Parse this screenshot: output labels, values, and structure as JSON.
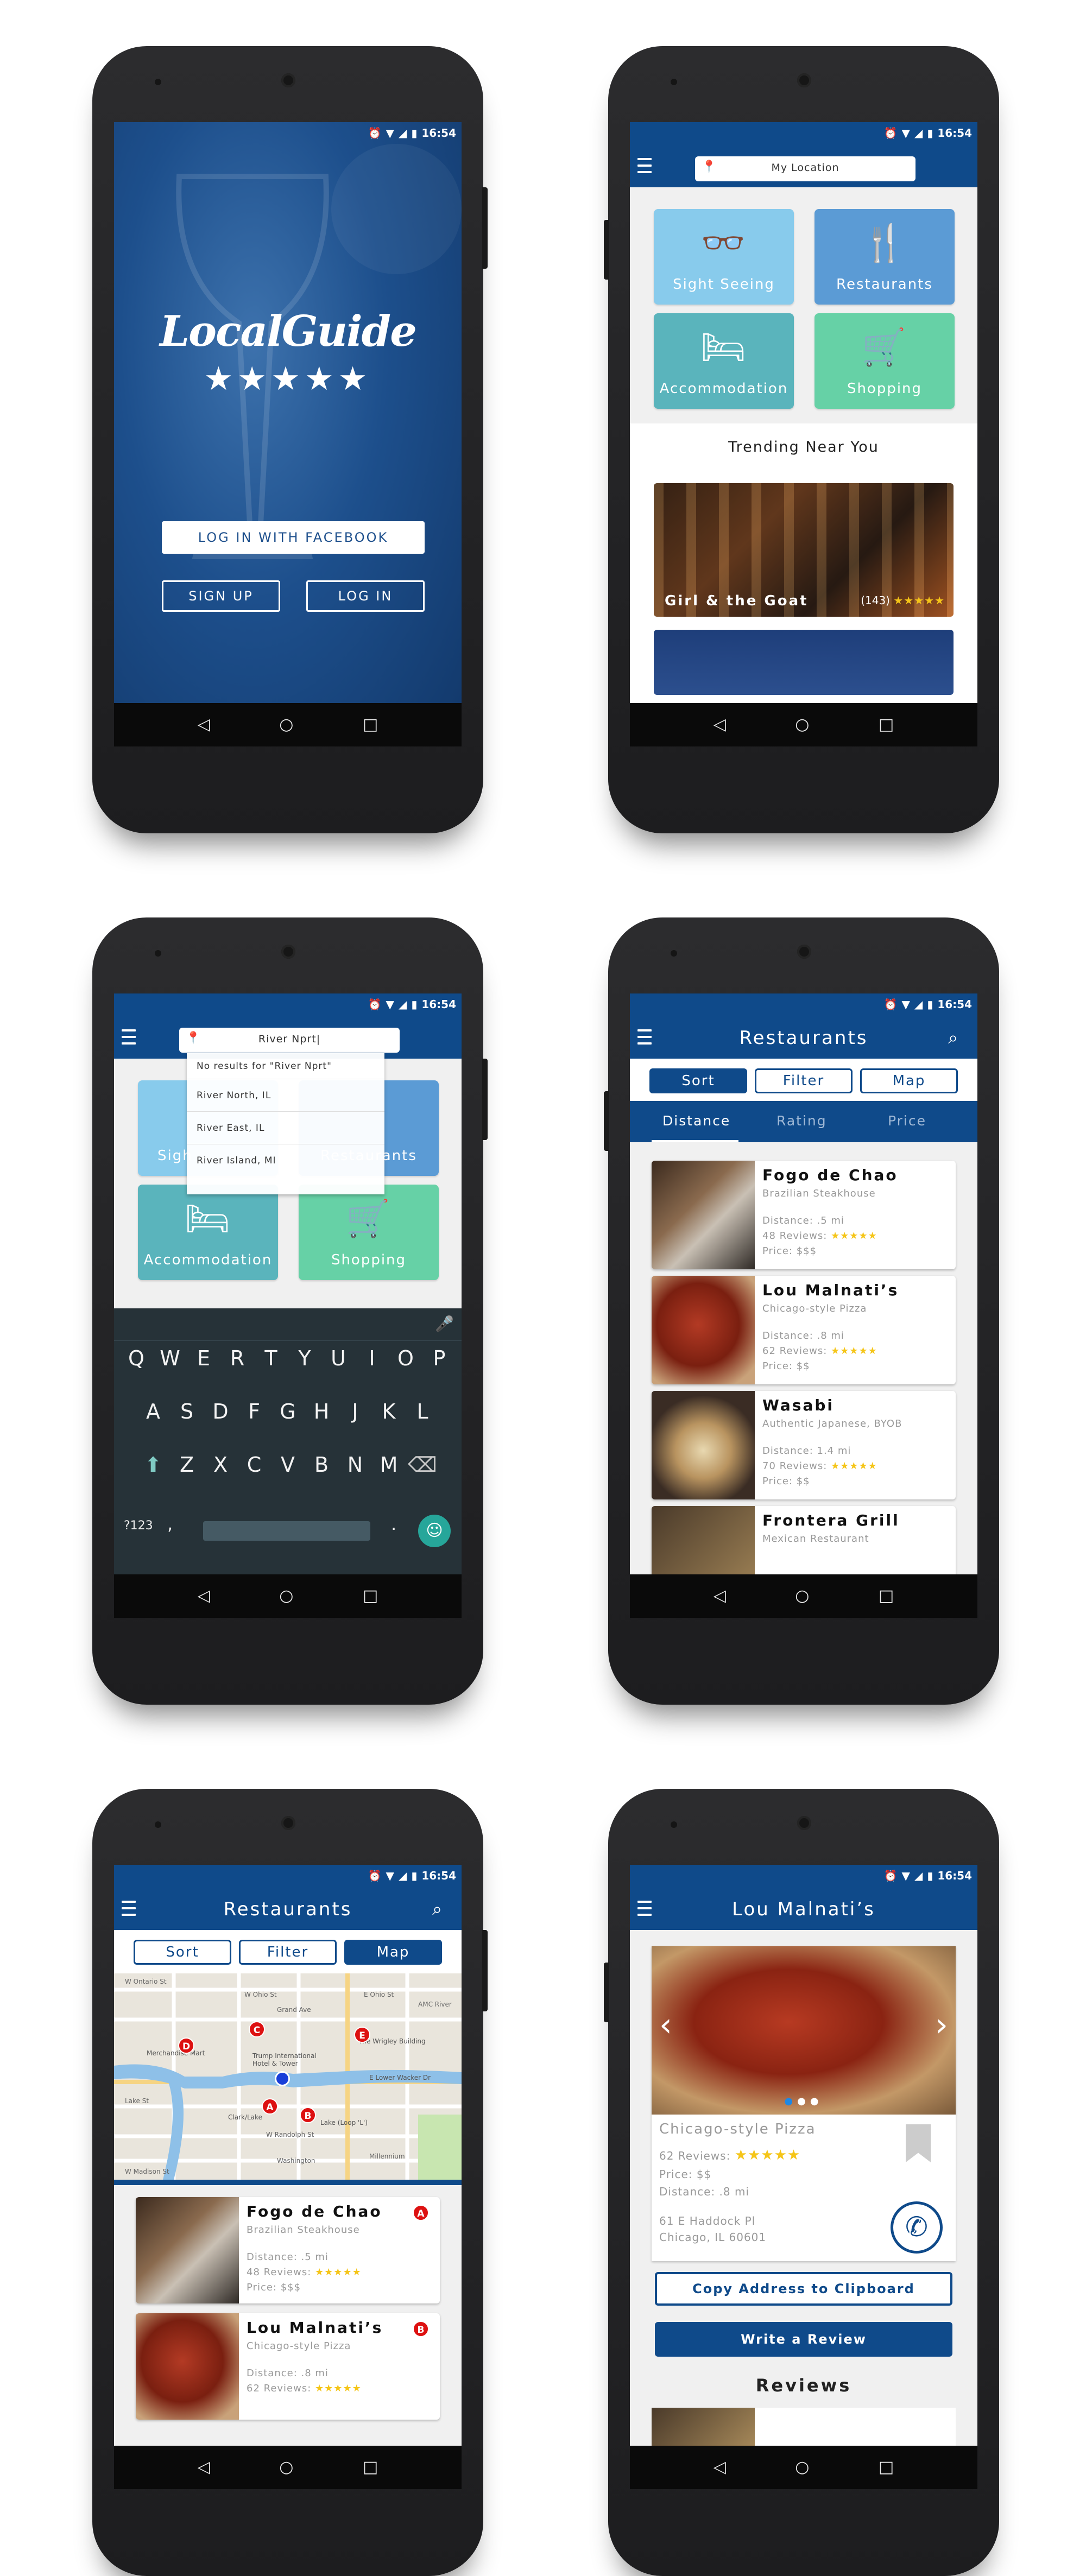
{
  "status": {
    "time": "16:54"
  },
  "login": {
    "brand": "LocalGuide",
    "rating_stars": 5,
    "stars_text": "★★★★★",
    "facebook_button": "LOG IN WITH FACEBOOK",
    "signup_button": "SIGN UP",
    "login_button": "LOG IN"
  },
  "home": {
    "location_placeholder": "My Location",
    "tiles": [
      {
        "label": "Sight Seeing",
        "icon": "binoculars-icon",
        "color": "#88cbec"
      },
      {
        "label": "Restaurants",
        "icon": "fork-knife-icon",
        "color": "#5b9bd5"
      },
      {
        "label": "Accommodation",
        "icon": "bed-icon",
        "color": "#5ab4bc"
      },
      {
        "label": "Shopping",
        "icon": "cart-icon",
        "color": "#66d1a6"
      }
    ],
    "trending_title": "Trending Near You",
    "trending": [
      {
        "name": "Girl & the Goat",
        "reviews": "(143)",
        "stars": "★★★★★"
      }
    ]
  },
  "search": {
    "query": "River Nprt|",
    "suggestions": [
      "No results for \"River Nprt\"",
      "River North, IL",
      "River East, IL",
      "River Island, MI"
    ],
    "tiles_partial": [
      "Sigh",
      "Restaurants"
    ],
    "tiles": [
      "Accommodation",
      "Shopping"
    ],
    "keyboard": {
      "row1": [
        "Q",
        "W",
        "E",
        "R",
        "T",
        "Y",
        "U",
        "I",
        "O",
        "P"
      ],
      "row2": [
        "A",
        "S",
        "D",
        "F",
        "G",
        "H",
        "J",
        "K",
        "L"
      ],
      "row3": [
        "Z",
        "X",
        "C",
        "V",
        "B",
        "N",
        "M"
      ],
      "num_key": "?123",
      "comma": ",",
      "period": "."
    }
  },
  "list": {
    "title": "Restaurants",
    "segments": [
      "Sort",
      "Filter",
      "Map"
    ],
    "sort_tabs": [
      "Distance",
      "Rating",
      "Price"
    ],
    "items": [
      {
        "name": "Fogo de Chao",
        "cuisine": "Brazilian Steakhouse",
        "distance": "Distance: .5 mi",
        "reviews": "48 Reviews:",
        "stars": "★★★★★",
        "stars_off": "",
        "price": "Price: $$$"
      },
      {
        "name": "Lou Malnati’s",
        "cuisine": "Chicago-style Pizza",
        "distance": "Distance: .8 mi",
        "reviews": "62 Reviews:",
        "stars": "★★★★",
        "stars_off": "★",
        "price": "Price: $$"
      },
      {
        "name": "Wasabi",
        "cuisine": "Authentic Japanese, BYOB",
        "distance": "Distance: 1.4 mi",
        "reviews": "70 Reviews:",
        "stars": "★★★★",
        "stars_off": "★",
        "price": "Price: $$"
      },
      {
        "name": "Frontera Grill",
        "cuisine": "Mexican Restaurant"
      }
    ]
  },
  "map": {
    "title": "Restaurants",
    "segments": [
      "Sort",
      "Filter",
      "Map"
    ],
    "labels": [
      "W Ontario St",
      "W Ohio St",
      "E Ohio St",
      "Grand Ave",
      "Merchandise Mart",
      "Trump International Hotel & Tower",
      "The Wrigley Building",
      "Lake St",
      "W Randolph St",
      "Washington",
      "W Madison St",
      "Millennium",
      "AMC River",
      "Clark/Lake",
      "Lake (Loop 'L')",
      "E Lower Wacker Dr"
    ],
    "pins": [
      "A",
      "B",
      "C",
      "D",
      "E"
    ],
    "items": [
      {
        "name": "Fogo de Chao",
        "cuisine": "Brazilian Steakhouse",
        "distance": "Distance: .5 mi",
        "reviews": "48 Reviews:",
        "stars": "★★★★★",
        "stars_off": "",
        "price": "Price: $$$",
        "pin": "A"
      },
      {
        "name": "Lou Malnati’s",
        "cuisine": "Chicago-style Pizza",
        "distance": "Distance: .8 mi",
        "reviews": "62 Reviews:",
        "stars": "★★★★",
        "stars_off": "★",
        "pin": "B"
      }
    ]
  },
  "detail": {
    "title": "Lou Malnati’s",
    "cuisine": "Chicago-style Pizza",
    "reviews": "62 Reviews:",
    "stars": "★★★★",
    "stars_off": "★",
    "price": "Price: $$",
    "distance": "Distance: .8 mi",
    "address1": "61 E Haddock Pl",
    "address2": "Chicago, IL 60601",
    "copy_button": "Copy Address to Clipboard",
    "review_button": "Write a Review",
    "reviews_title": "Reviews",
    "photo_count": 3,
    "photo_index": 1
  }
}
